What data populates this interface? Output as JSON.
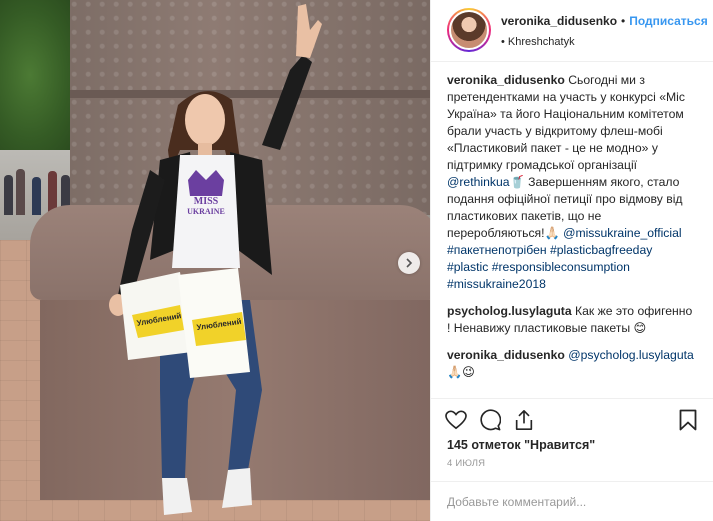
{
  "photo": {
    "shirt_logo_line1": "MISS",
    "shirt_logo_line2": "UKRAINE",
    "bag_text": "Улюблений"
  },
  "header": {
    "username": "veronika_didusenko",
    "separator": "•",
    "follow_label": "Подписаться",
    "location_prefix": "•",
    "location": "Khreshchatyk"
  },
  "comments": [
    {
      "user": "veronika_didusenko",
      "text_1": " Сьогодні ми з претендентками на участь у конкурсі «Міс Україна» та його Національним комітетом брали участь у відкритому флеш-мобі «Пластиковий пакет - це не модно» у підтримку громадської організації ",
      "mention_1": "@rethinkua",
      "text_2": "🥤 Завершенням якого, стало подання офіційної петиції про відмову від пластикових пакетів, що не переробляються!🙏🏻 ",
      "mention_2": "@missukraine_official",
      "tags": " #пакетнепотрібен #plasticbagfreeday #plastic #responsibleconsumption #missukraine2018"
    },
    {
      "user": "psycholog.lusylaguta",
      "text": " Как же это офигенно ! Ненавижу пластиковые пакеты 😊"
    },
    {
      "user": "veronika_didusenko",
      "mention": "@psycholog.lusylaguta",
      "text": " 🙏🏻😉"
    }
  ],
  "actions": {
    "like_icon": "heart-icon",
    "comment_icon": "comment-bubble-icon",
    "share_icon": "share-icon",
    "save_icon": "bookmark-icon"
  },
  "likes_text": "145 отметок \"Нравится\"",
  "date_text": "4 ИЮЛЯ",
  "add_comment_placeholder": "Добавьте комментарий...",
  "colors": {
    "follow": "#3897f0",
    "link": "#003569",
    "muted": "#999999"
  }
}
